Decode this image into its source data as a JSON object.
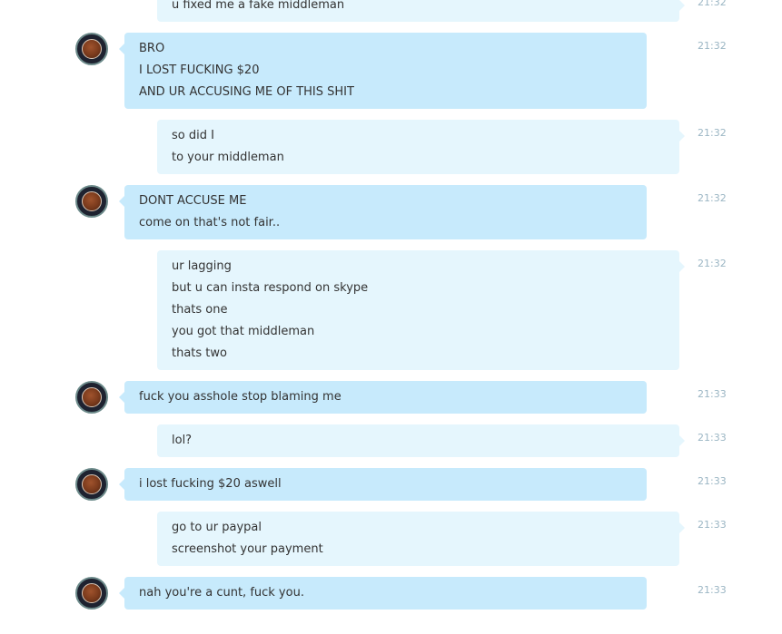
{
  "colors": {
    "incoming_bubble": "#c7eafc",
    "outgoing_bubble": "#e5f6fd",
    "timestamp": "#9bb6c4"
  },
  "messages": [
    {
      "direction": "out",
      "time": "21:32",
      "lines": [
        "u fixed me a fake middleman"
      ]
    },
    {
      "direction": "in",
      "avatar": "coffee-cup-avatar",
      "time": "21:32",
      "lines": [
        "BRO",
        "I LOST FUCKING $20",
        "AND UR ACCUSING ME OF THIS SHIT"
      ]
    },
    {
      "direction": "out",
      "time": "21:32",
      "lines": [
        "so did I",
        "to your middleman"
      ]
    },
    {
      "direction": "in",
      "avatar": "coffee-cup-avatar",
      "time": "21:32",
      "lines": [
        "DONT ACCUSE ME",
        "come on that's not fair.."
      ]
    },
    {
      "direction": "out",
      "time": "21:32",
      "lines": [
        "ur lagging",
        "but u can insta respond on skype",
        "thats one",
        "you got that middleman",
        "thats two"
      ]
    },
    {
      "direction": "in",
      "avatar": "coffee-cup-avatar",
      "time": "21:33",
      "lines": [
        "fuck you asshole stop blaming me"
      ]
    },
    {
      "direction": "out",
      "time": "21:33",
      "lines": [
        "lol?"
      ]
    },
    {
      "direction": "in",
      "avatar": "coffee-cup-avatar",
      "time": "21:33",
      "lines": [
        "i lost fucking $20 aswell"
      ]
    },
    {
      "direction": "out",
      "time": "21:33",
      "lines": [
        "go to ur paypal",
        "screenshot your payment"
      ]
    },
    {
      "direction": "in",
      "avatar": "coffee-cup-avatar",
      "time": "21:33",
      "lines": [
        "nah you're a cunt, fuck you."
      ]
    }
  ]
}
